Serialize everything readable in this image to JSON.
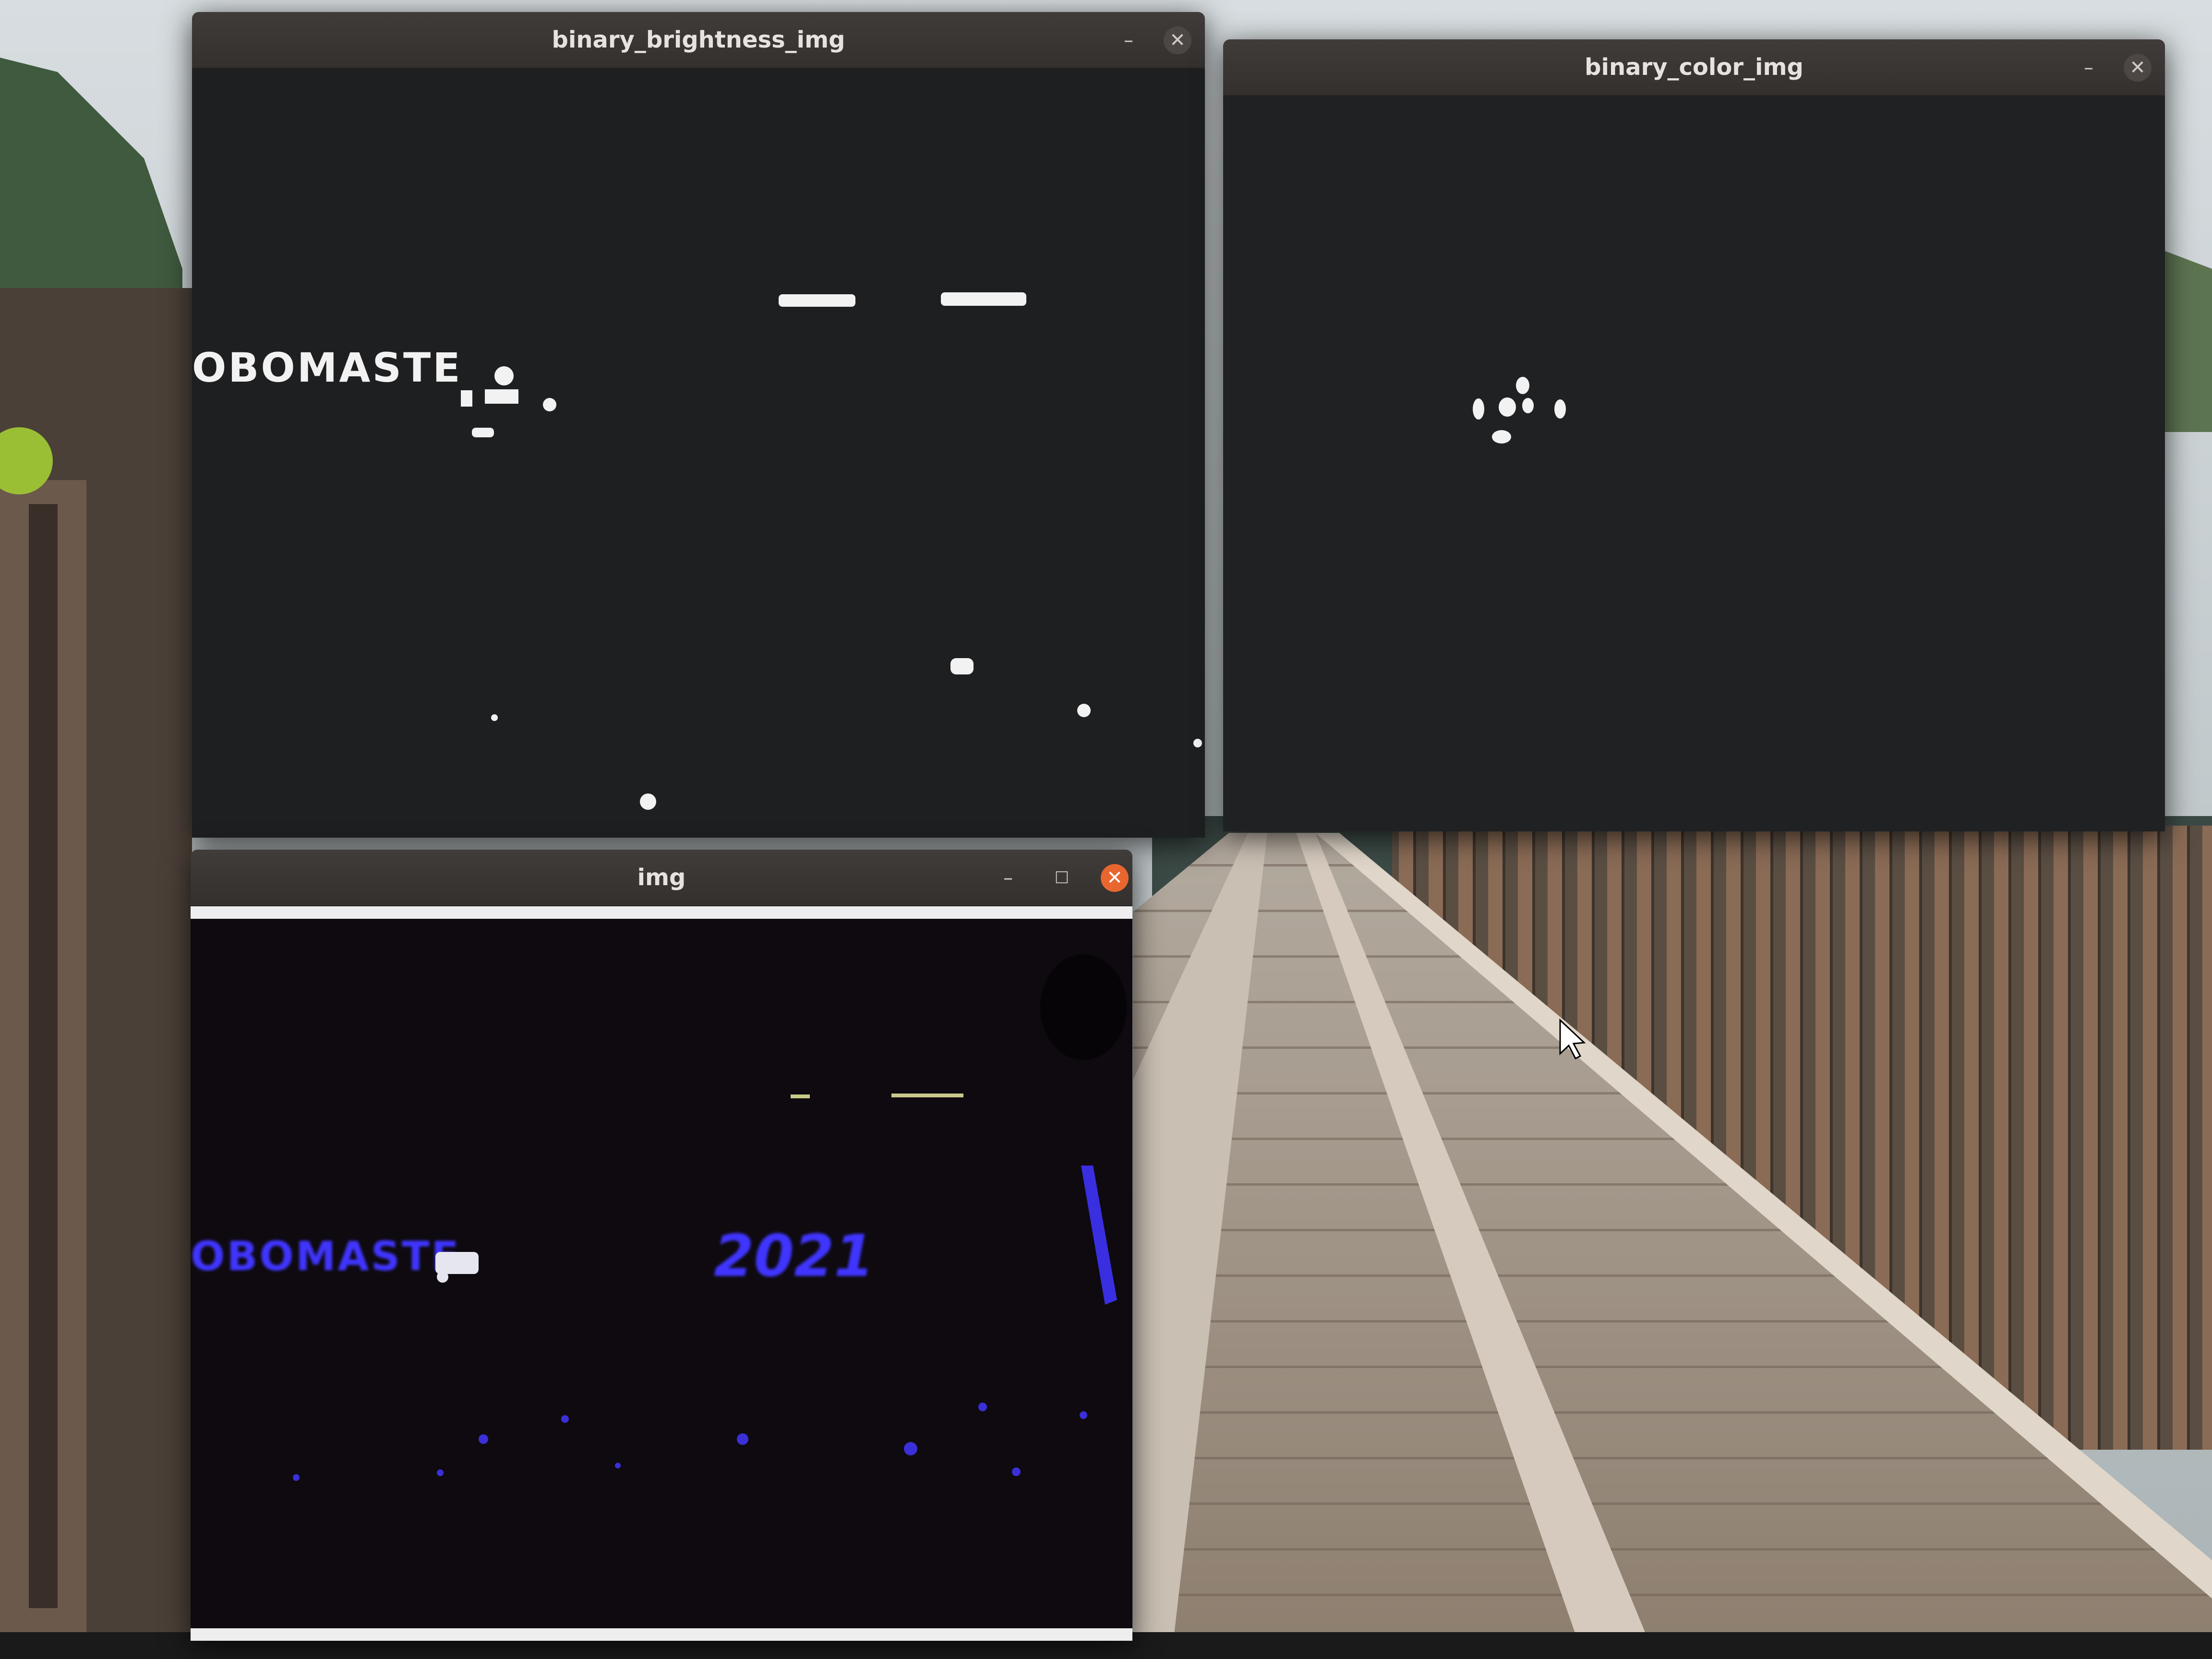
{
  "desktop": {
    "wallpaper": "wooden-boardwalk-bridge-photo",
    "cursor": "arrow-cursor-icon"
  },
  "windows": {
    "binary_brightness": {
      "title": "binary_brightness_img",
      "controls": {
        "minimize": "–",
        "close": "✕"
      },
      "overlay_text": "OBOMASTE"
    },
    "binary_color": {
      "title": "binary_color_img",
      "controls": {
        "minimize": "–",
        "close": "✕"
      }
    },
    "img": {
      "title": "img",
      "controls": {
        "minimize": "–",
        "maximize": "☐",
        "close": "✕"
      },
      "overlay_text": "OBOMASTE",
      "year_text": "2021"
    }
  },
  "colors": {
    "titlebar": "#3a3634",
    "close_active": "#e9662f",
    "window_bg": "#1d1f21",
    "blue_glow": "#3f35ff"
  }
}
